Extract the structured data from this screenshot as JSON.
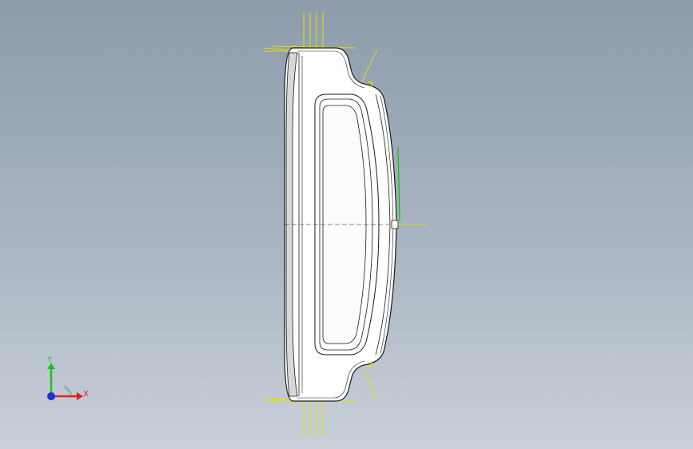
{
  "viewport": {
    "background_top": "#8d9bab",
    "background_bottom": "#c8d0d9"
  },
  "model": {
    "body_fill": "#ffffff",
    "edge_color": "#1a1a1a",
    "relation_color": "#e5e000",
    "sketch_color": "#00cc00"
  },
  "triad": {
    "x_label": "X",
    "y_label": "Y",
    "x_color": "#e02020",
    "y_color": "#20c020",
    "z_color": "#1a33d6"
  }
}
